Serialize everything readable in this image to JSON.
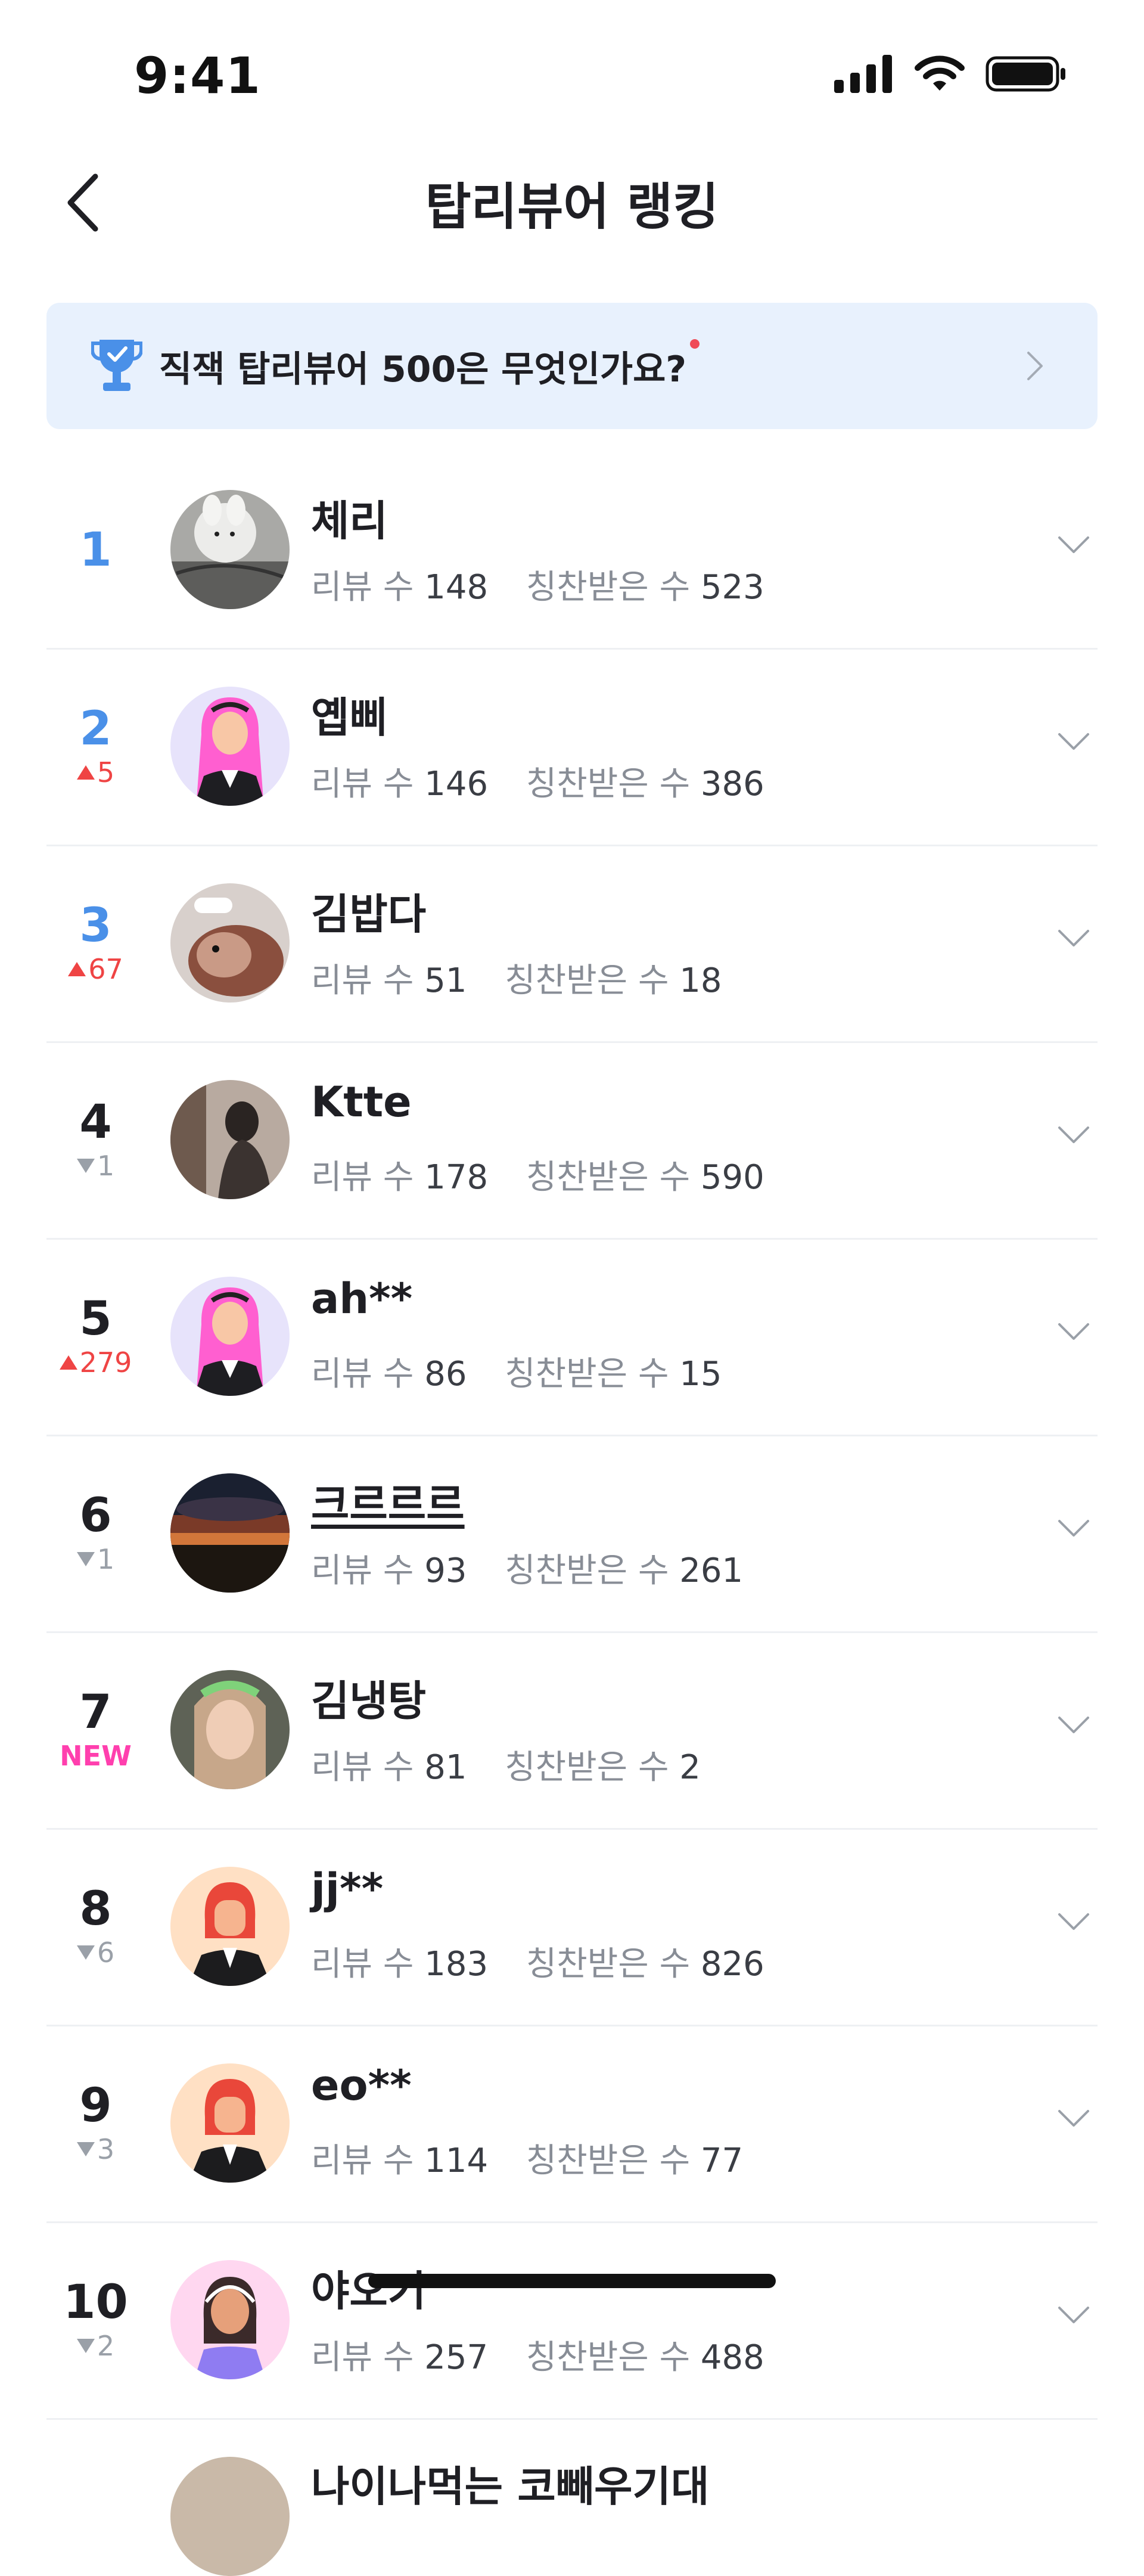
{
  "status_bar": {
    "time": "9:41",
    "icons": [
      "cellular-signal-icon",
      "wifi-icon",
      "battery-icon"
    ]
  },
  "header": {
    "title": "탑리뷰어 랭킹",
    "back_icon": "chevron-left-icon"
  },
  "banner": {
    "text": "직잭 탑리뷰어 500은 무엇인가요?",
    "icon": "trophy-icon",
    "has_new_dot": true
  },
  "labels": {
    "review_count": "리뷰 수",
    "praise_count": "칭찬받은 수"
  },
  "colors": {
    "accent_blue": "#4a90e8",
    "up_red": "#ef4444",
    "down_gray": "#9aa0a8",
    "new_pink": "#ff3fae",
    "banner_bg": "#e8f1fd"
  },
  "rankings": [
    {
      "rank": "1",
      "change": "",
      "change_dir": "none",
      "name": "체리",
      "reviews": "148",
      "praises": "523",
      "avatar": "plush-toy-photo"
    },
    {
      "rank": "2",
      "change": "5",
      "change_dir": "up",
      "name": "옙삐",
      "reviews": "146",
      "praises": "386",
      "avatar": "pink-hair-illustration"
    },
    {
      "rank": "3",
      "change": "67",
      "change_dir": "up",
      "name": "김밥다",
      "reviews": "51",
      "praises": "18",
      "avatar": "hamster-photo"
    },
    {
      "rank": "4",
      "change": "1",
      "change_dir": "down",
      "name": "Ktte",
      "reviews": "178",
      "praises": "590",
      "avatar": "person-photo"
    },
    {
      "rank": "5",
      "change": "279",
      "change_dir": "up",
      "name": "ah**",
      "reviews": "86",
      "praises": "15",
      "avatar": "pink-hair-illustration"
    },
    {
      "rank": "6",
      "change": "1",
      "change_dir": "down",
      "name": "크르르르",
      "reviews": "93",
      "praises": "261",
      "avatar": "sunset-photo"
    },
    {
      "rank": "7",
      "change": "NEW",
      "change_dir": "new",
      "name": "김냉탕",
      "reviews": "81",
      "praises": "2",
      "avatar": "selfie-photo"
    },
    {
      "rank": "8",
      "change": "6",
      "change_dir": "down",
      "name": "jj**",
      "reviews": "183",
      "praises": "826",
      "avatar": "red-hair-illustration"
    },
    {
      "rank": "9",
      "change": "3",
      "change_dir": "down",
      "name": "eo**",
      "reviews": "114",
      "praises": "77",
      "avatar": "red-hair-illustration"
    },
    {
      "rank": "10",
      "change": "2",
      "change_dir": "down",
      "name": "야오기",
      "reviews": "257",
      "praises": "488",
      "avatar": "headset-illustration"
    }
  ],
  "partial_next_row": {
    "name": "나이나먹는 코빼우기대"
  }
}
